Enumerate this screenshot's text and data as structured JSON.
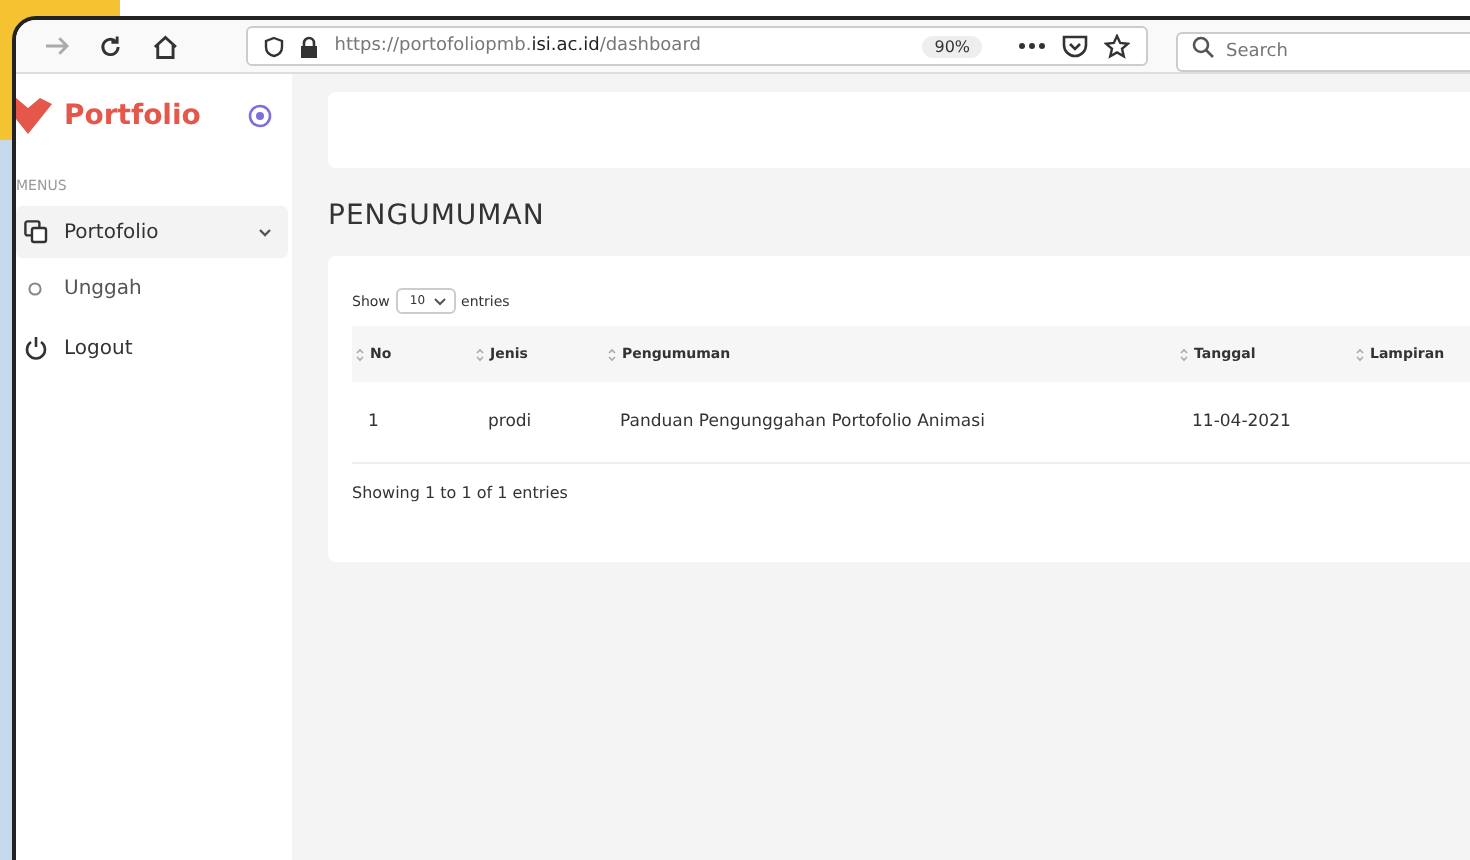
{
  "browser": {
    "url": "https://portofoliopmb.**isi.ac.id**/dashboard",
    "zoom": "90%",
    "search": {
      "placeholder": "Search"
    }
  },
  "sidebar": {
    "brand": "Portfolio",
    "section": "MENUS",
    "items": [
      {
        "label": "Portofolio",
        "kind": "group",
        "selected": true,
        "expanded": true,
        "children": [
          {
            "label": "Unggah",
            "selected": false
          }
        ]
      },
      {
        "label": "Logout",
        "kind": "link",
        "selected": false
      }
    ]
  },
  "page": {
    "title": "PENGUMUMAN"
  },
  "table": {
    "show_label": "Show",
    "page_size": "10",
    "entries_label": "entries",
    "columns": [
      "No",
      "Jenis",
      "Pengumuman",
      "Tanggal",
      "Lampiran"
    ],
    "rows": [
      [
        "1",
        "prodi",
        "Panduan Pengunggahan Portofolio Animasi",
        "11-04-2021",
        ""
      ]
    ],
    "info": "Showing 1 to 1 of 1 entries"
  }
}
